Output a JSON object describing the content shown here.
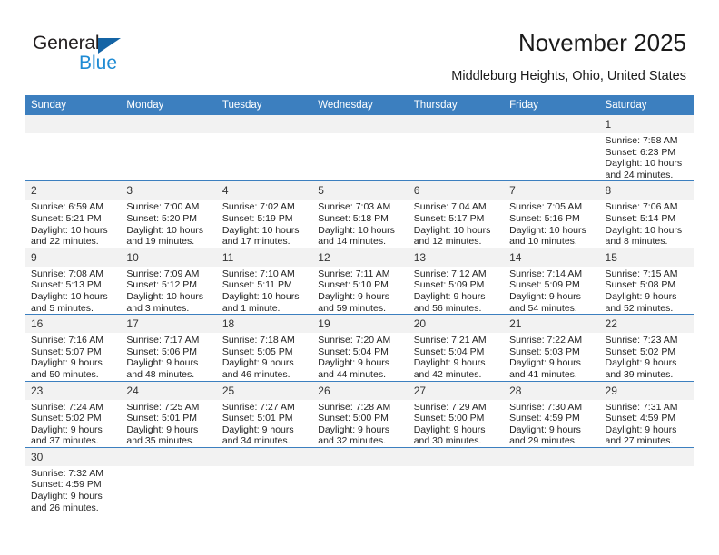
{
  "brand": {
    "name_part1": "General",
    "name_part2": "Blue",
    "accent_color": "#1e8bd4",
    "triangle_color": "#1464a5"
  },
  "header": {
    "title": "November 2025",
    "subtitle": "Middleburg Heights, Ohio, United States"
  },
  "calendar": {
    "header_bg": "#3c7fbf",
    "daynum_bg": "#f2f2f2",
    "weekday_headers": [
      "Sunday",
      "Monday",
      "Tuesday",
      "Wednesday",
      "Thursday",
      "Friday",
      "Saturday"
    ],
    "weeks": [
      [
        {
          "day": "",
          "sunrise": "",
          "sunset": "",
          "daylight": "",
          "daylight2": ""
        },
        {
          "day": "",
          "sunrise": "",
          "sunset": "",
          "daylight": "",
          "daylight2": ""
        },
        {
          "day": "",
          "sunrise": "",
          "sunset": "",
          "daylight": "",
          "daylight2": ""
        },
        {
          "day": "",
          "sunrise": "",
          "sunset": "",
          "daylight": "",
          "daylight2": ""
        },
        {
          "day": "",
          "sunrise": "",
          "sunset": "",
          "daylight": "",
          "daylight2": ""
        },
        {
          "day": "",
          "sunrise": "",
          "sunset": "",
          "daylight": "",
          "daylight2": ""
        },
        {
          "day": "1",
          "sunrise": "Sunrise: 7:58 AM",
          "sunset": "Sunset: 6:23 PM",
          "daylight": "Daylight: 10 hours",
          "daylight2": "and 24 minutes."
        }
      ],
      [
        {
          "day": "2",
          "sunrise": "Sunrise: 6:59 AM",
          "sunset": "Sunset: 5:21 PM",
          "daylight": "Daylight: 10 hours",
          "daylight2": "and 22 minutes."
        },
        {
          "day": "3",
          "sunrise": "Sunrise: 7:00 AM",
          "sunset": "Sunset: 5:20 PM",
          "daylight": "Daylight: 10 hours",
          "daylight2": "and 19 minutes."
        },
        {
          "day": "4",
          "sunrise": "Sunrise: 7:02 AM",
          "sunset": "Sunset: 5:19 PM",
          "daylight": "Daylight: 10 hours",
          "daylight2": "and 17 minutes."
        },
        {
          "day": "5",
          "sunrise": "Sunrise: 7:03 AM",
          "sunset": "Sunset: 5:18 PM",
          "daylight": "Daylight: 10 hours",
          "daylight2": "and 14 minutes."
        },
        {
          "day": "6",
          "sunrise": "Sunrise: 7:04 AM",
          "sunset": "Sunset: 5:17 PM",
          "daylight": "Daylight: 10 hours",
          "daylight2": "and 12 minutes."
        },
        {
          "day": "7",
          "sunrise": "Sunrise: 7:05 AM",
          "sunset": "Sunset: 5:16 PM",
          "daylight": "Daylight: 10 hours",
          "daylight2": "and 10 minutes."
        },
        {
          "day": "8",
          "sunrise": "Sunrise: 7:06 AM",
          "sunset": "Sunset: 5:14 PM",
          "daylight": "Daylight: 10 hours",
          "daylight2": "and 8 minutes."
        }
      ],
      [
        {
          "day": "9",
          "sunrise": "Sunrise: 7:08 AM",
          "sunset": "Sunset: 5:13 PM",
          "daylight": "Daylight: 10 hours",
          "daylight2": "and 5 minutes."
        },
        {
          "day": "10",
          "sunrise": "Sunrise: 7:09 AM",
          "sunset": "Sunset: 5:12 PM",
          "daylight": "Daylight: 10 hours",
          "daylight2": "and 3 minutes."
        },
        {
          "day": "11",
          "sunrise": "Sunrise: 7:10 AM",
          "sunset": "Sunset: 5:11 PM",
          "daylight": "Daylight: 10 hours",
          "daylight2": "and 1 minute."
        },
        {
          "day": "12",
          "sunrise": "Sunrise: 7:11 AM",
          "sunset": "Sunset: 5:10 PM",
          "daylight": "Daylight: 9 hours",
          "daylight2": "and 59 minutes."
        },
        {
          "day": "13",
          "sunrise": "Sunrise: 7:12 AM",
          "sunset": "Sunset: 5:09 PM",
          "daylight": "Daylight: 9 hours",
          "daylight2": "and 56 minutes."
        },
        {
          "day": "14",
          "sunrise": "Sunrise: 7:14 AM",
          "sunset": "Sunset: 5:09 PM",
          "daylight": "Daylight: 9 hours",
          "daylight2": "and 54 minutes."
        },
        {
          "day": "15",
          "sunrise": "Sunrise: 7:15 AM",
          "sunset": "Sunset: 5:08 PM",
          "daylight": "Daylight: 9 hours",
          "daylight2": "and 52 minutes."
        }
      ],
      [
        {
          "day": "16",
          "sunrise": "Sunrise: 7:16 AM",
          "sunset": "Sunset: 5:07 PM",
          "daylight": "Daylight: 9 hours",
          "daylight2": "and 50 minutes."
        },
        {
          "day": "17",
          "sunrise": "Sunrise: 7:17 AM",
          "sunset": "Sunset: 5:06 PM",
          "daylight": "Daylight: 9 hours",
          "daylight2": "and 48 minutes."
        },
        {
          "day": "18",
          "sunrise": "Sunrise: 7:18 AM",
          "sunset": "Sunset: 5:05 PM",
          "daylight": "Daylight: 9 hours",
          "daylight2": "and 46 minutes."
        },
        {
          "day": "19",
          "sunrise": "Sunrise: 7:20 AM",
          "sunset": "Sunset: 5:04 PM",
          "daylight": "Daylight: 9 hours",
          "daylight2": "and 44 minutes."
        },
        {
          "day": "20",
          "sunrise": "Sunrise: 7:21 AM",
          "sunset": "Sunset: 5:04 PM",
          "daylight": "Daylight: 9 hours",
          "daylight2": "and 42 minutes."
        },
        {
          "day": "21",
          "sunrise": "Sunrise: 7:22 AM",
          "sunset": "Sunset: 5:03 PM",
          "daylight": "Daylight: 9 hours",
          "daylight2": "and 41 minutes."
        },
        {
          "day": "22",
          "sunrise": "Sunrise: 7:23 AM",
          "sunset": "Sunset: 5:02 PM",
          "daylight": "Daylight: 9 hours",
          "daylight2": "and 39 minutes."
        }
      ],
      [
        {
          "day": "23",
          "sunrise": "Sunrise: 7:24 AM",
          "sunset": "Sunset: 5:02 PM",
          "daylight": "Daylight: 9 hours",
          "daylight2": "and 37 minutes."
        },
        {
          "day": "24",
          "sunrise": "Sunrise: 7:25 AM",
          "sunset": "Sunset: 5:01 PM",
          "daylight": "Daylight: 9 hours",
          "daylight2": "and 35 minutes."
        },
        {
          "day": "25",
          "sunrise": "Sunrise: 7:27 AM",
          "sunset": "Sunset: 5:01 PM",
          "daylight": "Daylight: 9 hours",
          "daylight2": "and 34 minutes."
        },
        {
          "day": "26",
          "sunrise": "Sunrise: 7:28 AM",
          "sunset": "Sunset: 5:00 PM",
          "daylight": "Daylight: 9 hours",
          "daylight2": "and 32 minutes."
        },
        {
          "day": "27",
          "sunrise": "Sunrise: 7:29 AM",
          "sunset": "Sunset: 5:00 PM",
          "daylight": "Daylight: 9 hours",
          "daylight2": "and 30 minutes."
        },
        {
          "day": "28",
          "sunrise": "Sunrise: 7:30 AM",
          "sunset": "Sunset: 4:59 PM",
          "daylight": "Daylight: 9 hours",
          "daylight2": "and 29 minutes."
        },
        {
          "day": "29",
          "sunrise": "Sunrise: 7:31 AM",
          "sunset": "Sunset: 4:59 PM",
          "daylight": "Daylight: 9 hours",
          "daylight2": "and 27 minutes."
        }
      ],
      [
        {
          "day": "30",
          "sunrise": "Sunrise: 7:32 AM",
          "sunset": "Sunset: 4:59 PM",
          "daylight": "Daylight: 9 hours",
          "daylight2": "and 26 minutes."
        },
        {
          "day": "",
          "sunrise": "",
          "sunset": "",
          "daylight": "",
          "daylight2": ""
        },
        {
          "day": "",
          "sunrise": "",
          "sunset": "",
          "daylight": "",
          "daylight2": ""
        },
        {
          "day": "",
          "sunrise": "",
          "sunset": "",
          "daylight": "",
          "daylight2": ""
        },
        {
          "day": "",
          "sunrise": "",
          "sunset": "",
          "daylight": "",
          "daylight2": ""
        },
        {
          "day": "",
          "sunrise": "",
          "sunset": "",
          "daylight": "",
          "daylight2": ""
        },
        {
          "day": "",
          "sunrise": "",
          "sunset": "",
          "daylight": "",
          "daylight2": ""
        }
      ]
    ]
  }
}
